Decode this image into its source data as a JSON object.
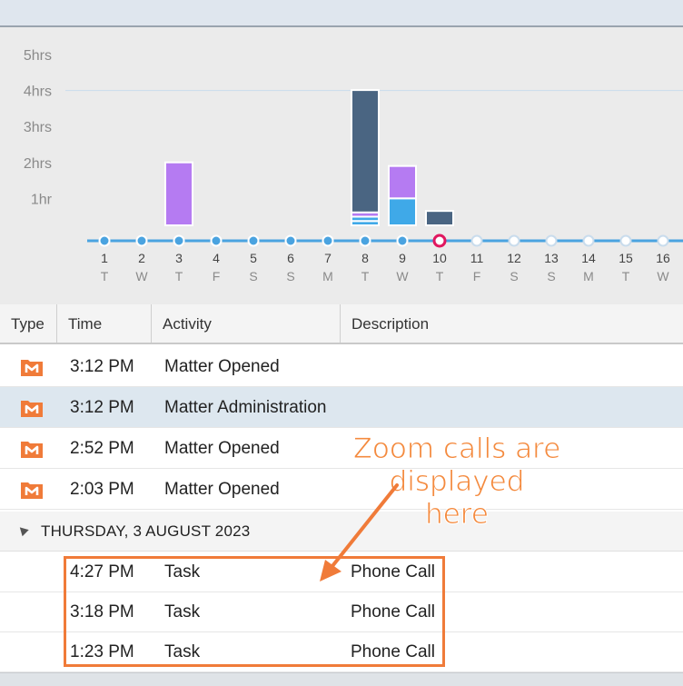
{
  "chart_data": {
    "type": "bar",
    "y_ticks": [
      "1hr",
      "2hrs",
      "3hrs",
      "4hrs",
      "5hrs"
    ],
    "ylim": [
      0,
      5
    ],
    "days": [
      {
        "day": "1",
        "weekday": "T"
      },
      {
        "day": "2",
        "weekday": "W"
      },
      {
        "day": "3",
        "weekday": "T"
      },
      {
        "day": "4",
        "weekday": "F"
      },
      {
        "day": "5",
        "weekday": "S"
      },
      {
        "day": "6",
        "weekday": "S"
      },
      {
        "day": "7",
        "weekday": "M"
      },
      {
        "day": "8",
        "weekday": "T"
      },
      {
        "day": "9",
        "weekday": "W"
      },
      {
        "day": "10",
        "weekday": "T"
      },
      {
        "day": "11",
        "weekday": "F"
      },
      {
        "day": "12",
        "weekday": "S"
      },
      {
        "day": "13",
        "weekday": "S"
      },
      {
        "day": "14",
        "weekday": "M"
      },
      {
        "day": "15",
        "weekday": "T"
      },
      {
        "day": "16",
        "weekday": "W"
      }
    ],
    "today_index": 9,
    "colors": {
      "purple": "#b57bf2",
      "navy": "#4a6582",
      "blue": "#3fa9e8",
      "axis": "#4aa3e0",
      "today": "#e0175f",
      "grid": "#c9dcec",
      "future_dot": "#ffffff"
    },
    "stacks": [
      {
        "day_index": 2,
        "segments": [
          {
            "hours": 1.75,
            "color": "purple"
          }
        ]
      },
      {
        "day_index": 7,
        "segments": [
          {
            "hours": 0.12,
            "color": "blue"
          },
          {
            "hours": 0.12,
            "color": "blue"
          },
          {
            "hours": 0.12,
            "color": "purple"
          },
          {
            "hours": 3.4,
            "color": "navy"
          }
        ]
      },
      {
        "day_index": 8,
        "segments": [
          {
            "hours": 0.75,
            "color": "blue"
          },
          {
            "hours": 0.9,
            "color": "purple"
          }
        ]
      },
      {
        "day_index": 9,
        "segments": [
          {
            "hours": 0.4,
            "color": "navy"
          }
        ]
      }
    ]
  },
  "table": {
    "headers": {
      "type": "Type",
      "time": "Time",
      "activity": "Activity",
      "description": "Description"
    },
    "rows": [
      {
        "time": "3:12 PM",
        "activity": "Matter Opened",
        "description": ""
      },
      {
        "time": "3:12 PM",
        "activity": "Matter Administration",
        "description": ""
      },
      {
        "time": "2:52 PM",
        "activity": "Matter Opened",
        "description": ""
      },
      {
        "time": "2:03 PM",
        "activity": "Matter Opened",
        "description": ""
      }
    ],
    "group": {
      "label": "THURSDAY, 3 AUGUST 2023",
      "rows": [
        {
          "time": "4:27 PM",
          "activity": "Task",
          "description": "Phone Call"
        },
        {
          "time": "3:18 PM",
          "activity": "Task",
          "description": "Phone Call"
        },
        {
          "time": "1:23 PM",
          "activity": "Task",
          "description": "Phone Call"
        }
      ]
    }
  },
  "annotation": {
    "line1": "Zoom calls are displayed",
    "line2": "here",
    "color": "#f48a3e"
  },
  "icons": {
    "matter": "matter-m-icon",
    "collapse": "collapse-triangle-icon"
  }
}
